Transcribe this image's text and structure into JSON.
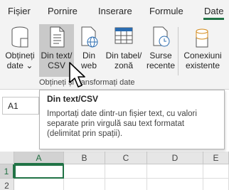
{
  "ribbon_tabs": [
    "Fișier",
    "Pornire",
    "Inserare",
    "Formule",
    "Date"
  ],
  "active_tab": "Date",
  "ribbon_buttons": [
    {
      "label": "Obțineți\ndate ⌄",
      "icon": "database-icon"
    },
    {
      "label": "Din text/\nCSV",
      "icon": "text-file-icon"
    },
    {
      "label": "Din\nweb",
      "icon": "web-page-icon"
    },
    {
      "label": "Din tabel/\nzonă",
      "icon": "table-icon"
    },
    {
      "label": "Surse\nrecente",
      "icon": "recent-sources-icon"
    },
    {
      "label": "Conexiuni\nexistente",
      "icon": "existing-connections-icon"
    }
  ],
  "group_label": "Obțineți și transformați date",
  "name_box": "A1",
  "tooltip": {
    "title": "Din text/CSV",
    "body": "Importați date dintr-un fișier text, cu valori separate prin virgulă sau text formatat (delimitat prin spații)."
  },
  "columns": [
    "A",
    "B",
    "C",
    "D",
    "E"
  ],
  "rows": [
    "1",
    "2"
  ],
  "colors": {
    "accent": "#217346",
    "ribbon_bg": "#f3f3f3",
    "hover": "#c9c9c9"
  }
}
